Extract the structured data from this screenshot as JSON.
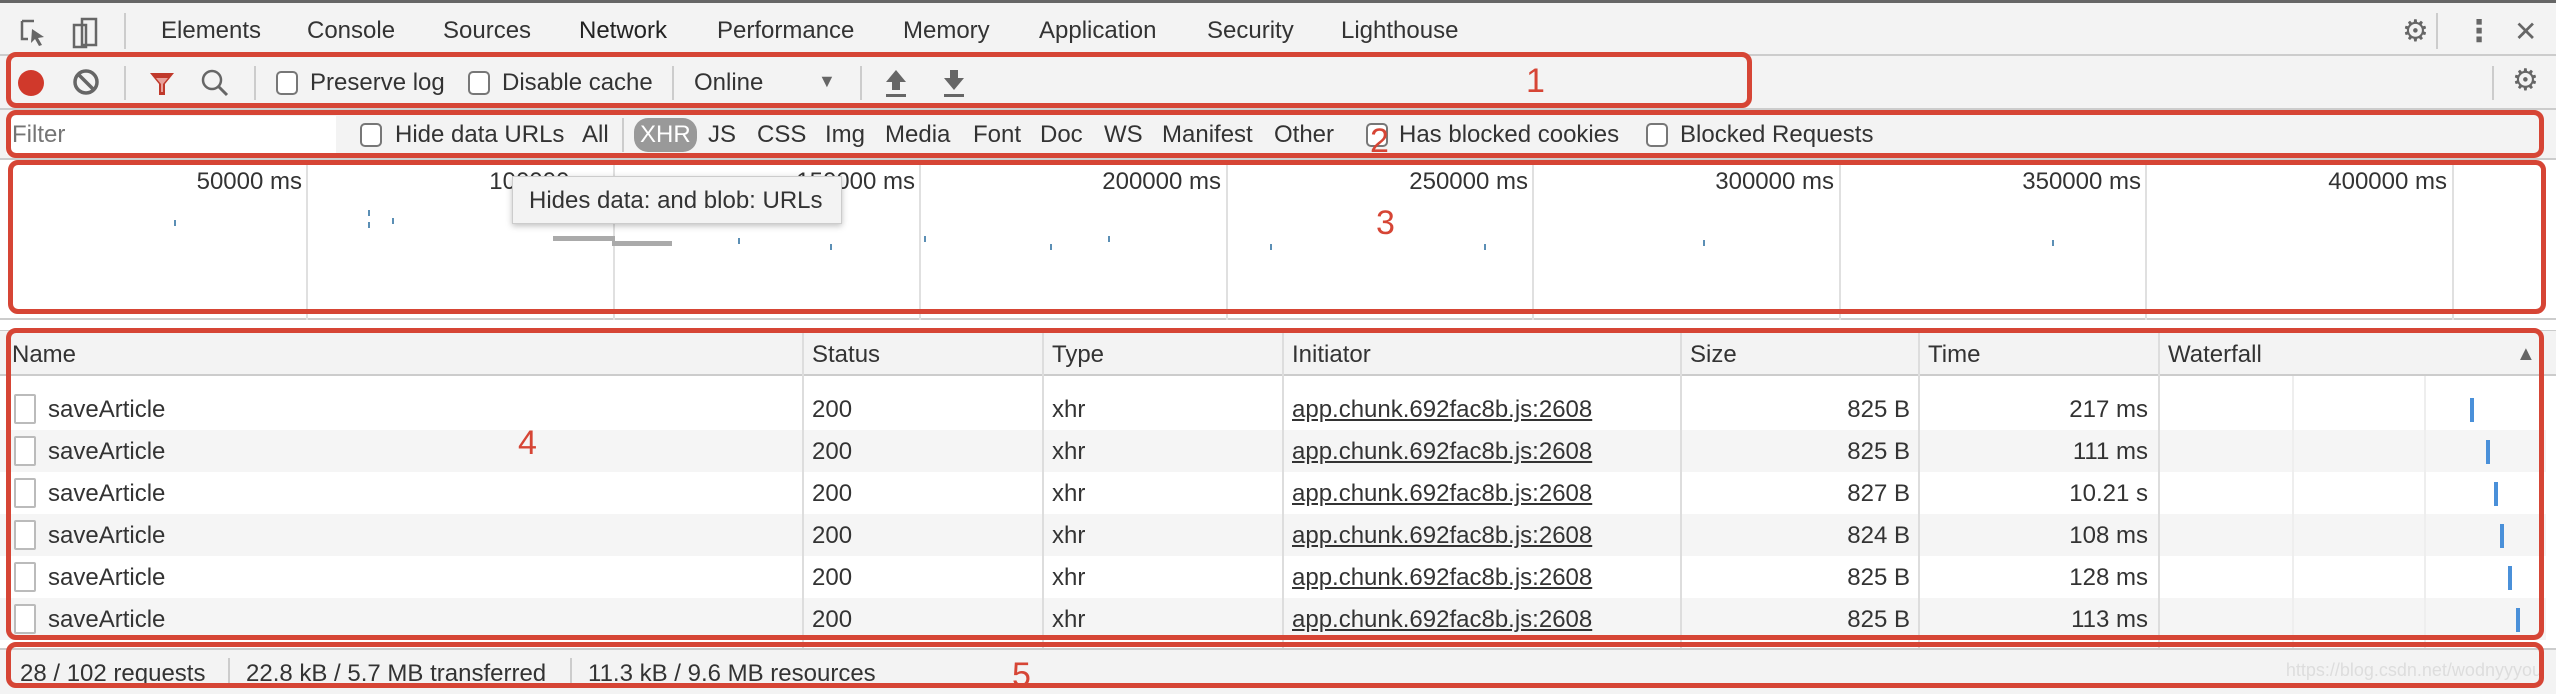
{
  "tabbar": {
    "tabs": [
      {
        "label": "Elements",
        "active": false
      },
      {
        "label": "Console",
        "active": false
      },
      {
        "label": "Sources",
        "active": false
      },
      {
        "label": "Network",
        "active": true
      },
      {
        "label": "Performance",
        "active": false
      },
      {
        "label": "Memory",
        "active": false
      },
      {
        "label": "Application",
        "active": false
      },
      {
        "label": "Security",
        "active": false
      },
      {
        "label": "Lighthouse",
        "active": false
      }
    ],
    "icons": [
      "inspect-element-icon",
      "device-toolbar-icon",
      "settings-gear-icon",
      "more-menu-icon",
      "close-icon"
    ]
  },
  "toolbar": {
    "record_state": "recording",
    "preserve_log_label": "Preserve log",
    "preserve_log_checked": false,
    "disable_cache_label": "Disable cache",
    "disable_cache_checked": false,
    "throttle_value": "Online",
    "record_color": "#d0392b",
    "filter_icon_color": "#c0392b"
  },
  "filterbar": {
    "filter_placeholder": "Filter",
    "hide_data_urls_label": "Hide data URLs",
    "hide_data_urls_checked": false,
    "types": [
      "All",
      "XHR",
      "JS",
      "CSS",
      "Img",
      "Media",
      "Font",
      "Doc",
      "WS",
      "Manifest",
      "Other"
    ],
    "selected_type": "XHR",
    "has_blocked_cookies_label": "Has blocked cookies",
    "blocked_requests_label": "Blocked Requests"
  },
  "overview": {
    "tick_labels": [
      "50000 ms",
      "100000 ms",
      "150000 ms",
      "200000 ms",
      "250000 ms",
      "300000 ms",
      "350000 ms",
      "400000 ms"
    ]
  },
  "tooltip": {
    "text": "Hides data: and blob: URLs"
  },
  "table": {
    "columns": [
      "Name",
      "Status",
      "Type",
      "Initiator",
      "Size",
      "Time",
      "Waterfall"
    ],
    "sort_indicator": "▲",
    "rows": [
      {
        "name": "saveArticle",
        "status": "200",
        "type": "xhr",
        "initiator": "app.chunk.692fac8b.js:2608",
        "size": "825 B",
        "time": "217 ms"
      },
      {
        "name": "saveArticle",
        "status": "200",
        "type": "xhr",
        "initiator": "app.chunk.692fac8b.js:2608",
        "size": "825 B",
        "time": "111 ms"
      },
      {
        "name": "saveArticle",
        "status": "200",
        "type": "xhr",
        "initiator": "app.chunk.692fac8b.js:2608",
        "size": "827 B",
        "time": "10.21 s"
      },
      {
        "name": "saveArticle",
        "status": "200",
        "type": "xhr",
        "initiator": "app.chunk.692fac8b.js:2608",
        "size": "824 B",
        "time": "108 ms"
      },
      {
        "name": "saveArticle",
        "status": "200",
        "type": "xhr",
        "initiator": "app.chunk.692fac8b.js:2608",
        "size": "825 B",
        "time": "128 ms"
      },
      {
        "name": "saveArticle",
        "status": "200",
        "type": "xhr",
        "initiator": "app.chunk.692fac8b.js:2608",
        "size": "825 B",
        "time": "113 ms"
      }
    ]
  },
  "statusbar": {
    "requests": "28 / 102 requests",
    "transferred": "22.8 kB / 5.7 MB transferred",
    "resources": "11.3 kB / 9.6 MB resources"
  },
  "annotations": {
    "labels": [
      "1",
      "2",
      "3",
      "4",
      "5"
    ],
    "color": "#d64535"
  },
  "watermark": "https://blog.csdn.net/wodnyyyou"
}
